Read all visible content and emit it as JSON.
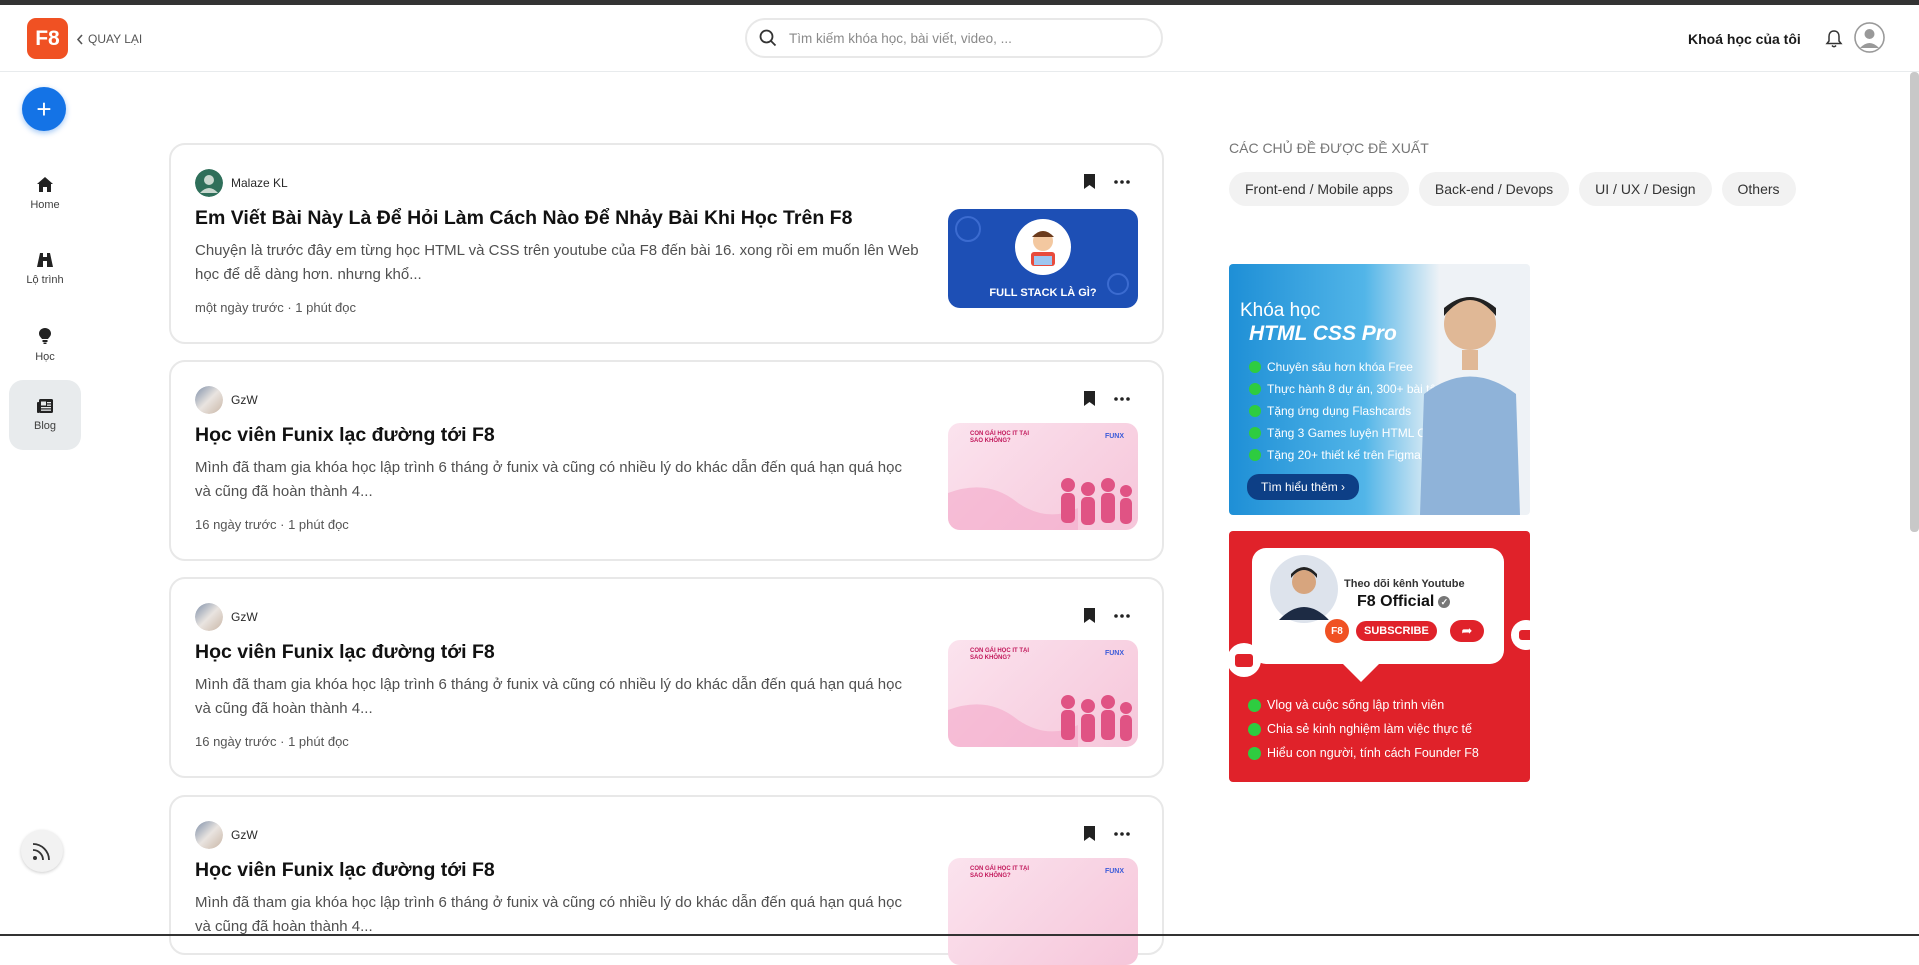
{
  "header": {
    "logo": "F8",
    "back_label": "QUAY LẠI",
    "search_placeholder": "Tìm kiếm khóa học, bài viết, video, ...",
    "my_courses": "Khoá học của tôi"
  },
  "sidebar": {
    "items": [
      {
        "label": "Home",
        "icon": "home-icon"
      },
      {
        "label": "Lộ trình",
        "icon": "road-icon"
      },
      {
        "label": "Học",
        "icon": "lightbulb-icon"
      },
      {
        "label": "Blog",
        "icon": "newspaper-icon",
        "active": true
      }
    ]
  },
  "posts": [
    {
      "author": "Malaze KL",
      "title": "Em Viết Bài Này Là Để Hỏi Làm Cách Nào Để Nhảy Bài Khi Học Trên F8",
      "desc": "Chuyện là trước đây em từng học HTML và CSS trên youtube của F8 đến bài 16. xong rồi em muốn lên Web học để dễ dàng hơn. nhưng khổ...",
      "meta": "một ngày trước · 1 phút đọc",
      "thumb_text": "FULL STACK LÀ GÌ?"
    },
    {
      "author": "GzW",
      "title": "Học viên Funix lạc đường tới F8",
      "desc": "Mình đã tham gia khóa học lập trình 6 tháng ở funix và cũng có nhiều lý do khác dẫn đến quá hạn quá học và cũng đã hoàn thành 4...",
      "meta": "16 ngày trước · 1 phút đọc",
      "thumb_text": "CON GÁI HỌC IT TẠI SAO KHÔNG?"
    },
    {
      "author": "GzW",
      "title": "Học viên Funix lạc đường tới F8",
      "desc": "Mình đã tham gia khóa học lập trình 6 tháng ở funix và cũng có nhiều lý do khác dẫn đến quá hạn quá học và cũng đã hoàn thành 4...",
      "meta": "16 ngày trước · 1 phút đọc",
      "thumb_text": "CON GÁI HỌC IT TẠI SAO KHÔNG?"
    },
    {
      "author": "GzW",
      "title": "Học viên Funix lạc đường tới F8",
      "desc": "Mình đã tham gia khóa học lập trình 6 tháng ở funix và cũng có nhiều lý do khác dẫn đến quá hạn quá học và cũng đã hoàn thành 4...",
      "meta": "",
      "thumb_text": "CON GÁI HỌC IT TẠI SAO KHÔNG?"
    }
  ],
  "thumb_brand": "FUNX",
  "topics": {
    "title": "CÁC CHỦ ĐỀ ĐƯỢC ĐỀ XUẤT",
    "chips": [
      "Front-end / Mobile apps",
      "Back-end / Devops",
      "UI / UX / Design",
      "Others"
    ]
  },
  "banner_html": {
    "line1": "Khóa học",
    "line2": "HTML CSS Pro",
    "features": [
      "Chuyên sâu hơn khóa Free",
      "Thực hành 8 dự án, 300+ bài tập",
      "Tặng ứng dụng Flashcards",
      "Tặng 3 Games luyện HTML CSS",
      "Tặng 20+ thiết kế trên Figma"
    ],
    "cta": "Tìm hiểu thêm"
  },
  "banner_youtube": {
    "follow": "Theo dõi kênh Youtube",
    "channel": "F8 Official",
    "subscribe": "SUBSCRIBE",
    "features": [
      "Vlog và cuộc sống lập trình viên",
      "Chia sẻ kinh nghiệm làm việc thực tế",
      "Hiểu con người, tính cách Founder F8"
    ]
  },
  "colors": {
    "brand": "#f05123",
    "accent": "#1473e6",
    "youtube_red": "#e0222a"
  }
}
